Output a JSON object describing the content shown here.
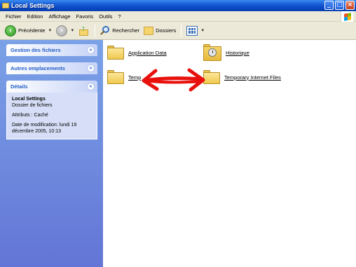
{
  "window": {
    "title": "Local Settings"
  },
  "menubar": {
    "items": [
      "Fichier",
      "Edition",
      "Affichage",
      "Favoris",
      "Outils",
      "?"
    ]
  },
  "toolbar": {
    "back_label": "Précédente",
    "search_label": "Rechercher",
    "folders_label": "Dossiers"
  },
  "taskpane": {
    "file_tasks": {
      "title": "Gestion des fichiers"
    },
    "other_places": {
      "title": "Autres emplacements"
    },
    "details": {
      "title": "Détails",
      "name": "Local Settings",
      "type": "Dossier de fichiers",
      "attributes": "Attributs : Caché",
      "modified_line1": "Date de modification: lundi 19",
      "modified_line2": "décembre 2005, 10:13"
    }
  },
  "content": {
    "items": [
      {
        "label": "Application Data",
        "icon": "folder-icon"
      },
      {
        "label": "Historique",
        "icon": "history-folder-icon"
      },
      {
        "label": "Temp",
        "icon": "folder-icon"
      },
      {
        "label": "Temporary Internet Files",
        "icon": "folder-icon"
      }
    ]
  },
  "colors": {
    "arrow": "#e8100c",
    "titlebar": "#0b48c4",
    "taskpane": "#7ba2e7"
  }
}
